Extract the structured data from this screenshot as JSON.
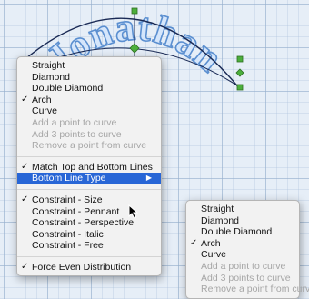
{
  "canvas": {
    "text": "Jonathan",
    "text_color": "#5b8fd0",
    "text_fill": "#d5e6fb",
    "guide_color": "#1a2a55",
    "handle_color": "#4caf3c"
  },
  "main_menu": {
    "items": [
      {
        "label": "Straight",
        "checked": false,
        "disabled": false
      },
      {
        "label": "Diamond",
        "checked": false,
        "disabled": false
      },
      {
        "label": "Double Diamond",
        "checked": false,
        "disabled": false
      },
      {
        "label": "Arch",
        "checked": true,
        "disabled": false
      },
      {
        "label": "Curve",
        "checked": false,
        "disabled": false
      },
      {
        "label": "Add a point to curve",
        "checked": false,
        "disabled": true
      },
      {
        "label": "Add 3 points to curve",
        "checked": false,
        "disabled": true
      },
      {
        "label": "Remove a point from curve",
        "checked": false,
        "disabled": true
      }
    ],
    "match_lines": {
      "label": "Match Top and Bottom Lines",
      "checked": true
    },
    "bottom_line_type": {
      "label": "Bottom Line Type",
      "highlighted": true
    },
    "constraints": [
      {
        "label": "Constraint - Size",
        "checked": true
      },
      {
        "label": "Constraint - Pennant",
        "checked": false
      },
      {
        "label": "Constraint - Perspective",
        "checked": false
      },
      {
        "label": "Constraint - Italic",
        "checked": false
      },
      {
        "label": "Constraint - Free",
        "checked": false
      }
    ],
    "force_even": {
      "label": "Force Even Distribution",
      "checked": true
    }
  },
  "sub_menu": {
    "items": [
      {
        "label": "Straight",
        "checked": false,
        "disabled": false
      },
      {
        "label": "Diamond",
        "checked": false,
        "disabled": false
      },
      {
        "label": "Double Diamond",
        "checked": false,
        "disabled": false
      },
      {
        "label": "Arch",
        "checked": true,
        "disabled": false
      },
      {
        "label": "Curve",
        "checked": false,
        "disabled": false
      },
      {
        "label": "Add a point to curve",
        "checked": false,
        "disabled": true
      },
      {
        "label": "Add 3 points to curve",
        "checked": false,
        "disabled": true
      },
      {
        "label": "Remove a point from curve",
        "checked": false,
        "disabled": true
      }
    ]
  },
  "check_glyph": "✓",
  "submenu_arrow_glyph": "▶",
  "highlight_color": "#2866d6"
}
